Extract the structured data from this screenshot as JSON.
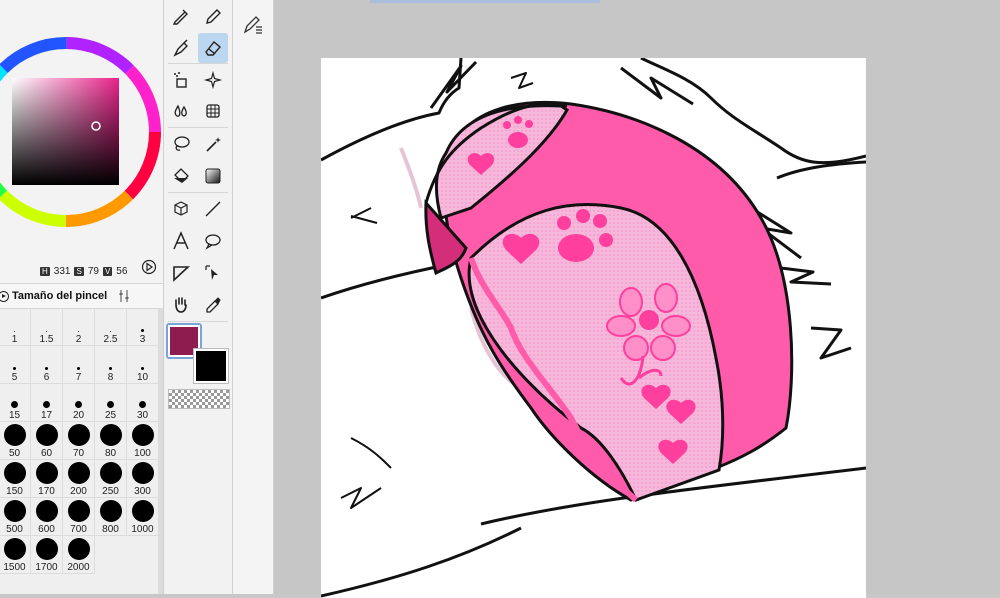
{
  "color_panel": {
    "readout": {
      "h_tag": "H",
      "h": "331",
      "s_tag": "S",
      "s": "79",
      "v_tag": "V",
      "v": "56"
    },
    "main_color": "#8e1c4e",
    "sub_color": "#000000"
  },
  "brush_panel": {
    "title": "Tamaño del pincel",
    "sizes": [
      "1",
      "1.5",
      "2",
      "2.5",
      "3",
      "5",
      "6",
      "7",
      "8",
      "10",
      "15",
      "17",
      "20",
      "25",
      "30",
      "50",
      "60",
      "70",
      "80",
      "100",
      "150",
      "170",
      "200",
      "250",
      "300",
      "500",
      "600",
      "700",
      "800",
      "1000",
      "1500",
      "1700",
      "2000"
    ]
  },
  "tools": [
    "pen-tool",
    "pencil-tool",
    "brush-tool",
    "eraser-tool",
    "blur-tool",
    "spray-tool",
    "water-tool",
    "transform-tool",
    "lasso-tool",
    "magic-wand-tool",
    "fill-tool",
    "gradient-tool",
    "3d-tool",
    "line-tool",
    "text-tool",
    "speech-bubble-tool",
    "ruler-tool",
    "select-tool",
    "hand-tool",
    "eyedropper-tool"
  ]
}
